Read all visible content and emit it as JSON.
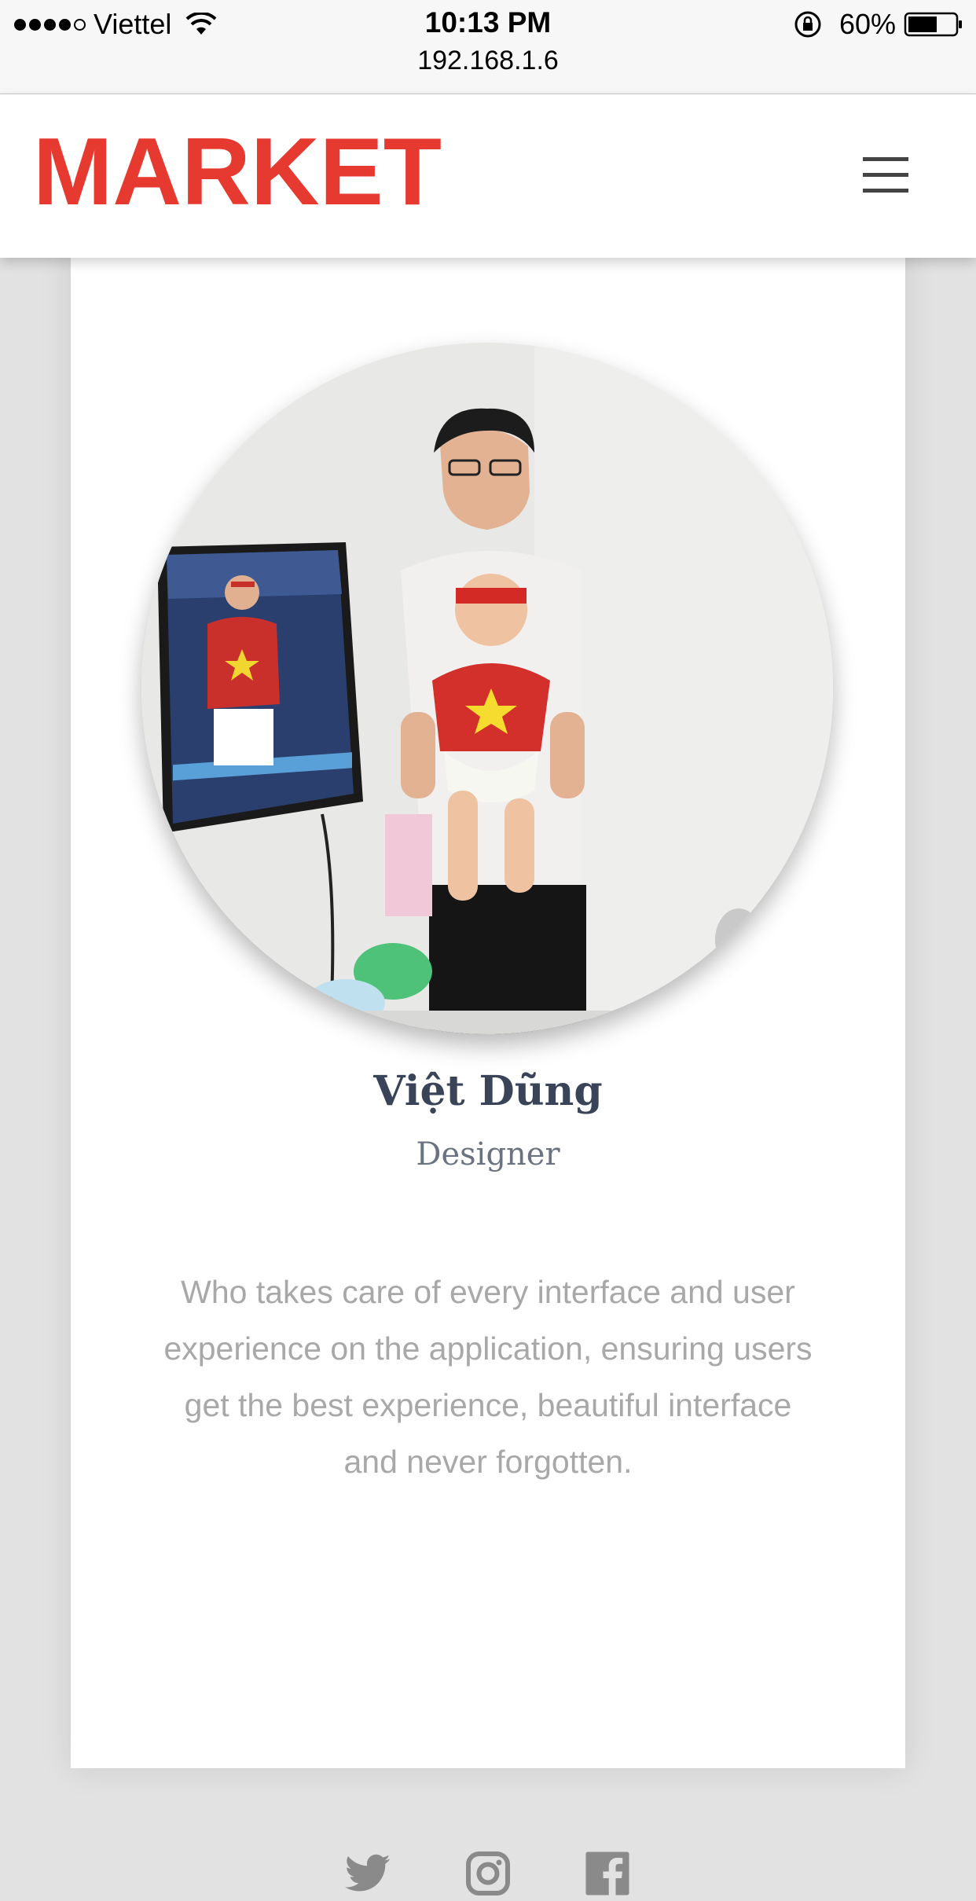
{
  "status_bar": {
    "carrier": "Viettel",
    "time": "10:13 PM",
    "url": "192.168.1.6",
    "battery": "60%"
  },
  "header": {
    "logo_text": "MARKET",
    "menu_icon": "hamburger-menu-icon"
  },
  "profile": {
    "name": "Việt Dũng",
    "role": "Designer",
    "bio": "Who takes care of every interface and user experience on the application, ensuring users get the best experience, beautiful interface and never forgotten.",
    "photo_icon": "profile-photo"
  },
  "social": [
    {
      "icon": "twitter-icon"
    },
    {
      "icon": "instagram-icon"
    },
    {
      "icon": "facebook-icon"
    }
  ],
  "colors": {
    "brand": "#e63a30",
    "name": "#3a4459",
    "icon": "#8a8a8a"
  }
}
